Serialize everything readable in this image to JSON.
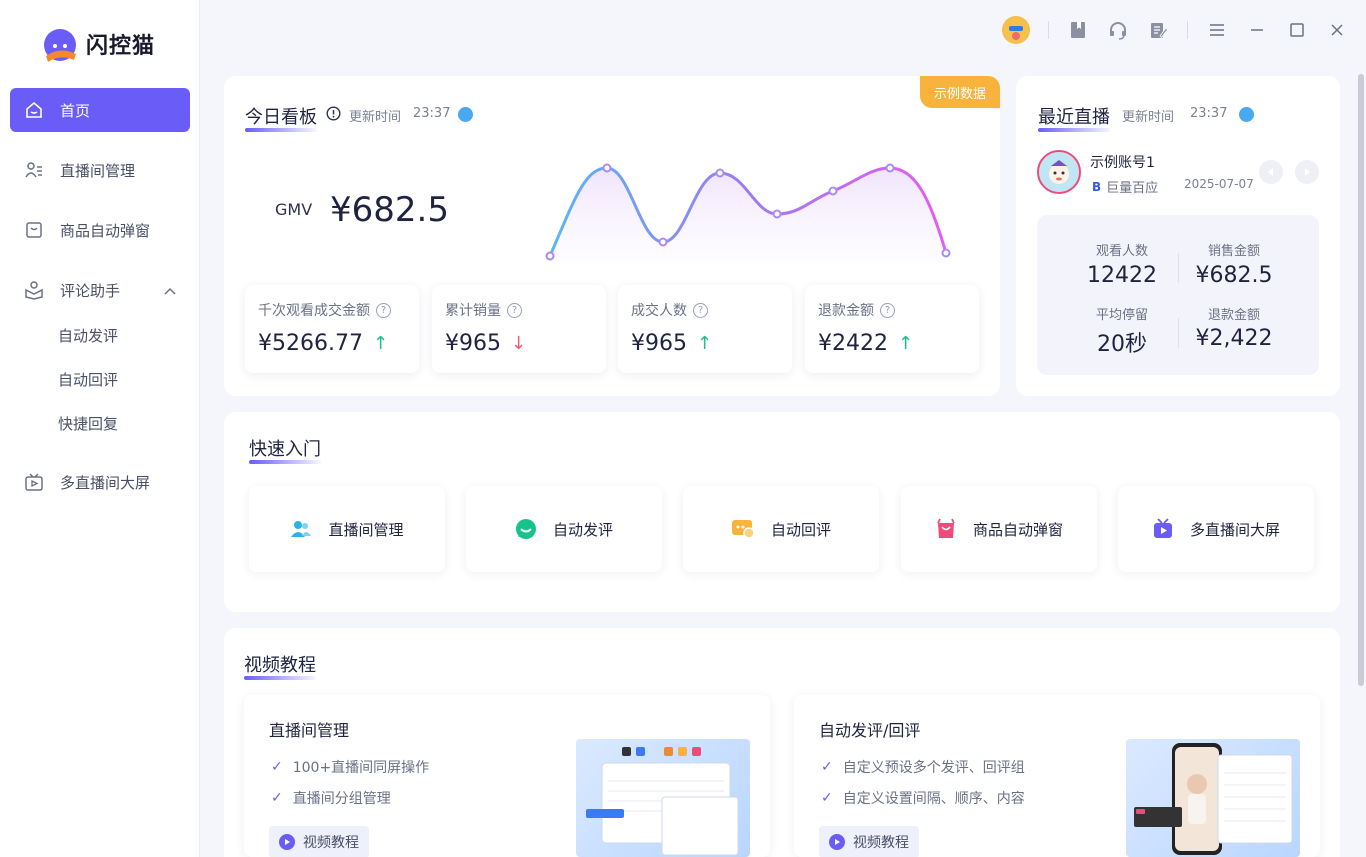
{
  "app": {
    "name": "闪控猫"
  },
  "sidebar": {
    "items": [
      {
        "label": "首页",
        "icon": "home-icon"
      },
      {
        "label": "直播间管理",
        "icon": "user-list-icon"
      },
      {
        "label": "商品自动弹窗",
        "icon": "bag-icon"
      },
      {
        "label": "评论助手",
        "icon": "comment-helper-icon"
      },
      {
        "label": "多直播间大屏",
        "icon": "tv-icon"
      }
    ],
    "sub_items": [
      "自动发评",
      "自动回评",
      "快捷回复"
    ]
  },
  "today_board": {
    "title": "今日看板",
    "update_label": "更新时间",
    "update_time": "23:37",
    "badge": "示例数据",
    "gmv_label": "GMV",
    "gmv_value": "¥682.5",
    "stats": [
      {
        "label": "千次观看成交金额",
        "value": "¥5266.77",
        "trend": "↑"
      },
      {
        "label": "累计销量",
        "value": "¥965",
        "trend": "↓"
      },
      {
        "label": "成交人数",
        "value": "¥965",
        "trend": "↑"
      },
      {
        "label": "退款金额",
        "value": "¥2422",
        "trend": "↑"
      }
    ]
  },
  "recent_live": {
    "title": "最近直播",
    "update_label": "更新时间",
    "update_time": "23:37",
    "account_name": "示例账号1",
    "platform": "巨量百应",
    "date": "2025-07-07",
    "stats": [
      {
        "label": "观看人数",
        "value": "12422"
      },
      {
        "label": "销售金额",
        "value": "¥682.5"
      },
      {
        "label": "平均停留",
        "value": "20秒"
      },
      {
        "label": "退款金额",
        "value": "¥2,422"
      }
    ]
  },
  "quick_start": {
    "title": "快速入门",
    "items": [
      {
        "label": "直播间管理",
        "icon": "users-icon",
        "color": "#2bb3e8"
      },
      {
        "label": "自动发评",
        "icon": "chat-bubble-icon",
        "color": "#17c28c"
      },
      {
        "label": "自动回评",
        "icon": "reply-bubble-icon",
        "color": "#f7b33c"
      },
      {
        "label": "商品自动弹窗",
        "icon": "shopping-bag-icon",
        "color": "#ef4a7a"
      },
      {
        "label": "多直播间大屏",
        "icon": "tv-screen-icon",
        "color": "#6a5cf6"
      }
    ]
  },
  "tutorials": {
    "title": "视频教程",
    "cards": [
      {
        "title": "直播间管理",
        "bullets": [
          "100+直播间同屏操作",
          "直播间分组管理"
        ],
        "button": "视频教程"
      },
      {
        "title": "自动发评/回评",
        "bullets": [
          "自定义预设多个发评、回评组",
          "自定义设置间隔、顺序、内容"
        ],
        "button": "视频教程"
      }
    ]
  },
  "colors": {
    "accent": "#6a5cf6",
    "badge": "#f7b33c",
    "up": "#1dbf8a",
    "down": "#ef5b7a"
  }
}
